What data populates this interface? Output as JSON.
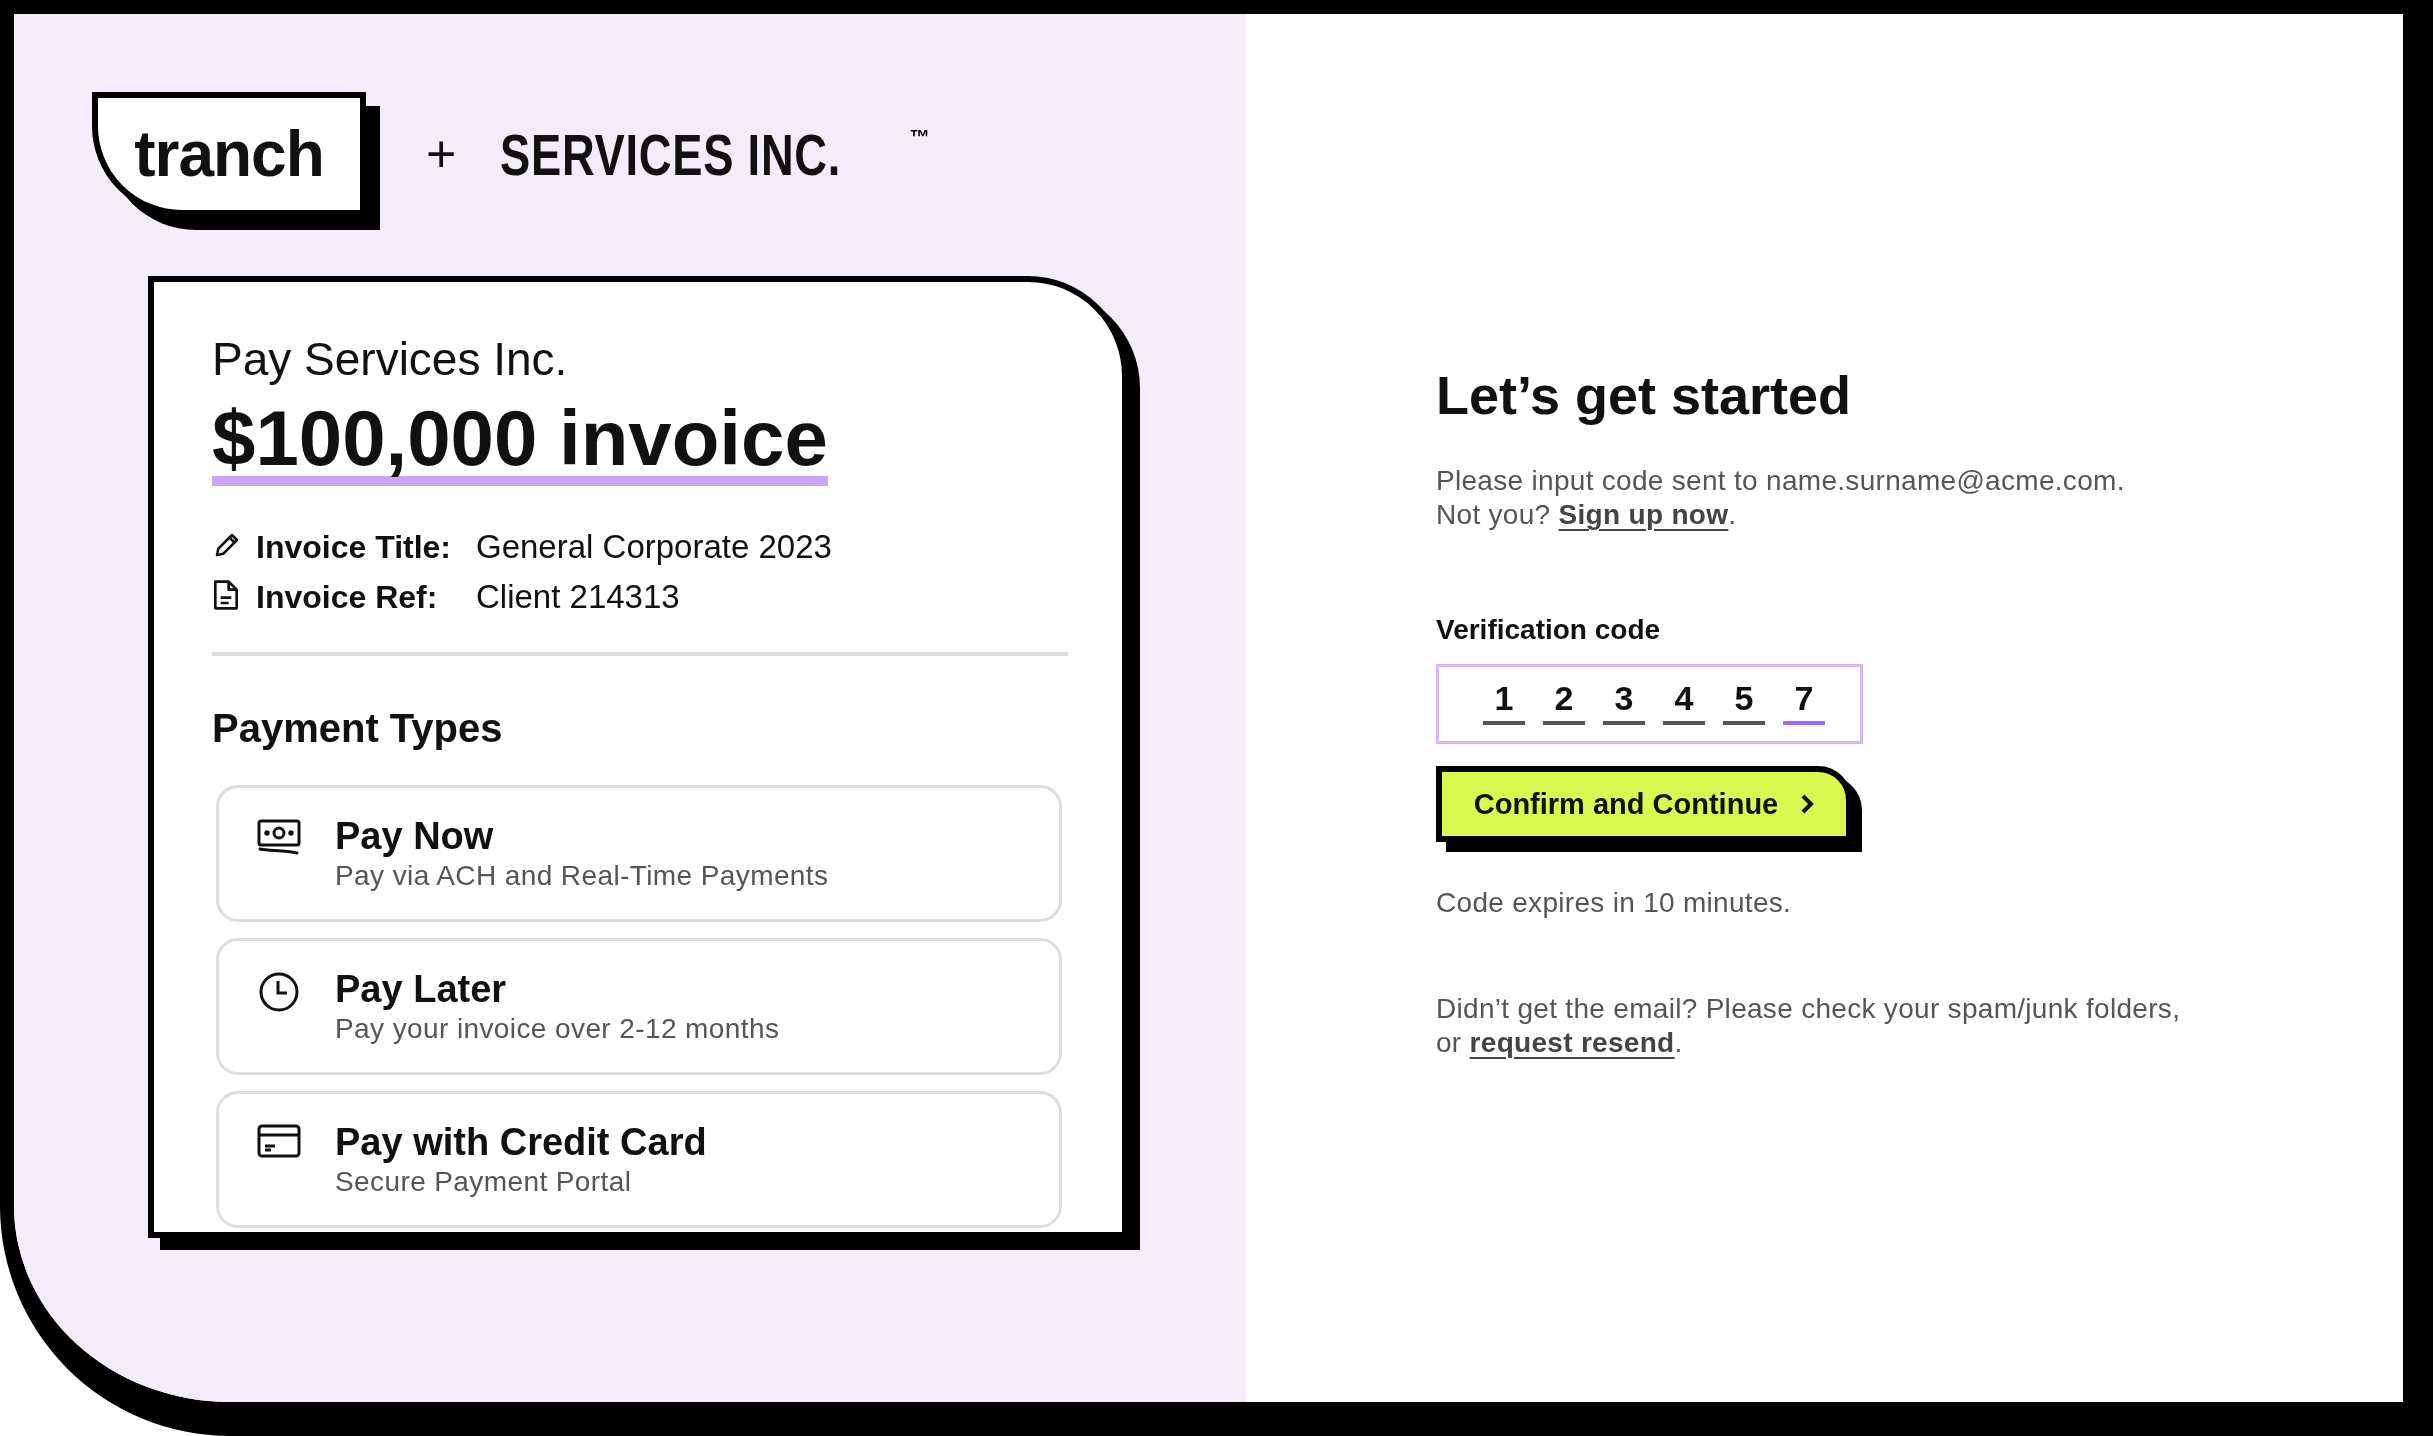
{
  "brand": {
    "logo": "tranch",
    "plus": "+",
    "partner": "SERVICES INC.",
    "trademark": "™"
  },
  "invoice": {
    "payee": "Pay Services Inc.",
    "amount": "$100,000 invoice",
    "details": [
      {
        "kind": "title",
        "label": "Invoice Title:",
        "value": "General Corporate 2023"
      },
      {
        "kind": "ref",
        "label": "Invoice Ref:",
        "value": "Client 214313"
      }
    ],
    "payment_types_heading": "Payment Types",
    "payment_types": [
      {
        "kind": "now",
        "title": "Pay Now",
        "subtitle": "Pay via ACH and Real-Time Payments"
      },
      {
        "kind": "later",
        "title": "Pay Later",
        "subtitle": "Pay your invoice over 2-12 months"
      },
      {
        "kind": "card",
        "title": "Pay with Credit Card",
        "subtitle": "Secure Payment Portal"
      }
    ]
  },
  "verify": {
    "heading": "Let’s get started",
    "intro": "Please input code sent to name.surname@acme.com.",
    "intro_prompt": "Not you?",
    "intro_link": "Sign up now",
    "intro_end": ".",
    "code_label": "Verification code",
    "code_digits": [
      {
        "digit": "1",
        "selected": false
      },
      {
        "digit": "2",
        "selected": false
      },
      {
        "digit": "3",
        "selected": false
      },
      {
        "digit": "4",
        "selected": false
      },
      {
        "digit": "5",
        "selected": false
      },
      {
        "digit": "7",
        "selected": true
      }
    ],
    "button": "Confirm and Continue",
    "expiry": "Code expires in 10 minutes.",
    "resend_text": "Didn’t get the email? Please check your spam/junk folders,",
    "resend_prompt": "or",
    "resend_link": "request resend",
    "resend_end": "."
  }
}
